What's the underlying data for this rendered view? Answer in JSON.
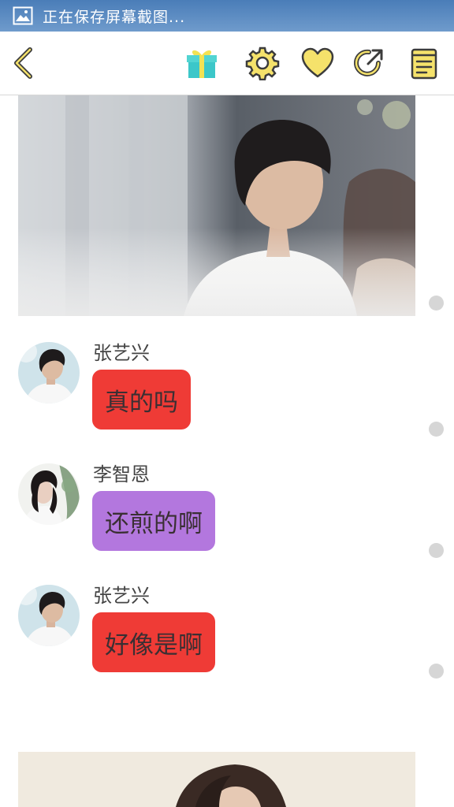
{
  "status_bar": {
    "text": "正在保存屏幕截图...",
    "icon": "image-icon"
  },
  "toolbar": {
    "back": "chevron-left-icon",
    "icons": [
      "gift-icon",
      "gear-icon",
      "heart-icon",
      "share-icon",
      "notebook-icon"
    ],
    "accent_color": "#f5e26b",
    "icon_stroke": "#3c3c3c"
  },
  "messages": [
    {
      "sender": "张艺兴",
      "text": "真的吗",
      "bubble_color": "#ef3b36"
    },
    {
      "sender": "李智恩",
      "text": "还煎的啊",
      "bubble_color": "#b377de"
    },
    {
      "sender": "张艺兴",
      "text": "好像是啊",
      "bubble_color": "#ef3b36"
    }
  ]
}
